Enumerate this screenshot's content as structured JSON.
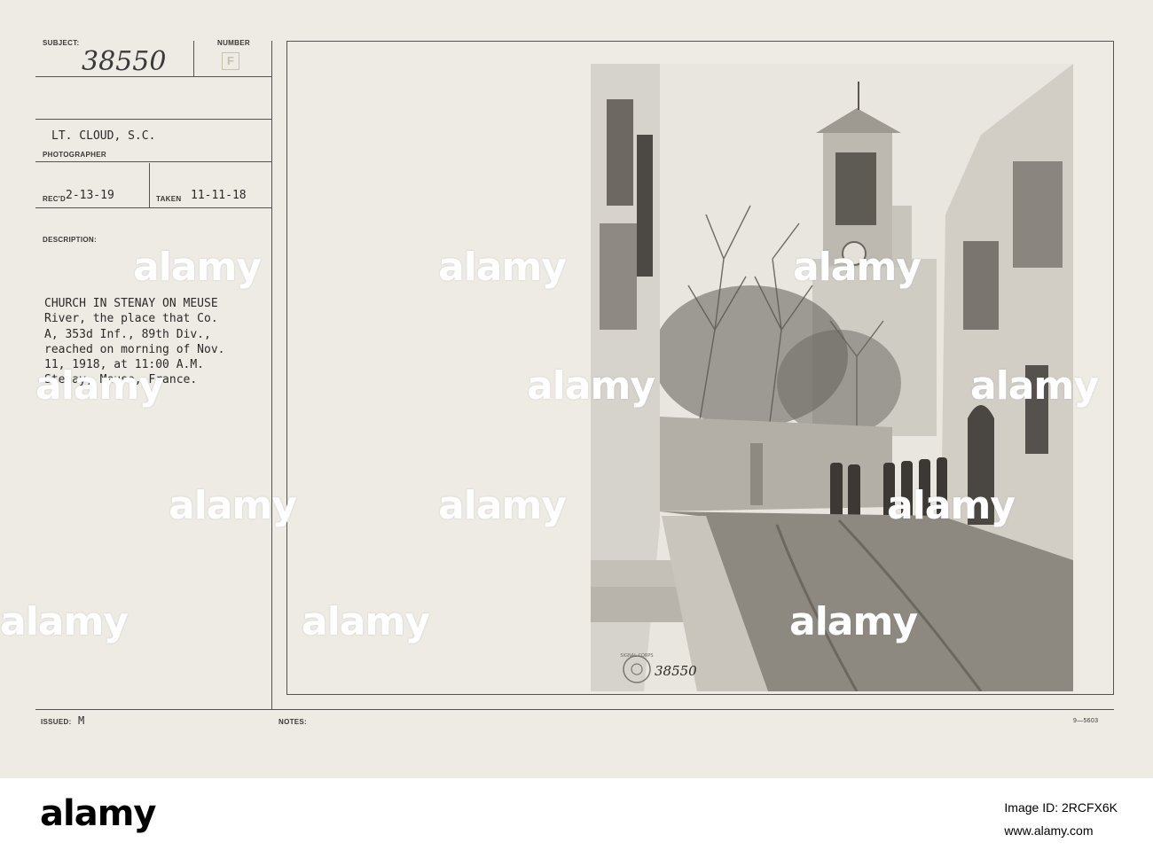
{
  "card": {
    "subject_label": "SUBJECT:",
    "subject_number": "38550",
    "number_label": "NUMBER",
    "number_stamp": "F",
    "photographer_name": "LT. CLOUD, S.C.",
    "photographer_label": "PHOTOGRAPHER",
    "received_label": "REC'D",
    "received_date": "2-13-19",
    "taken_label": "TAKEN",
    "taken_date": "11-11-18",
    "description_label": "DESCRIPTION:",
    "description_lines": [
      "CHURCH IN STENAY ON MEUSE",
      "River, the place that Co.",
      "A, 353d Inf., 89th Div.,",
      "reached on morning of Nov.",
      "11, 1918, at 11:00 A.M.",
      "Stenay, Meuse, France."
    ],
    "issued_label": "ISSUED:",
    "issued_value": "M",
    "notes_label": "NOTES:",
    "form_code": "9—5603"
  },
  "photo": {
    "negative_number": "38550",
    "seal_text": "SIGNAL CORPS"
  },
  "watermark": {
    "text": "alamy"
  },
  "footer": {
    "logo_text": "alamy",
    "image_id_label": "Image ID: 2RCFX6K",
    "site": "www.alamy.com"
  }
}
